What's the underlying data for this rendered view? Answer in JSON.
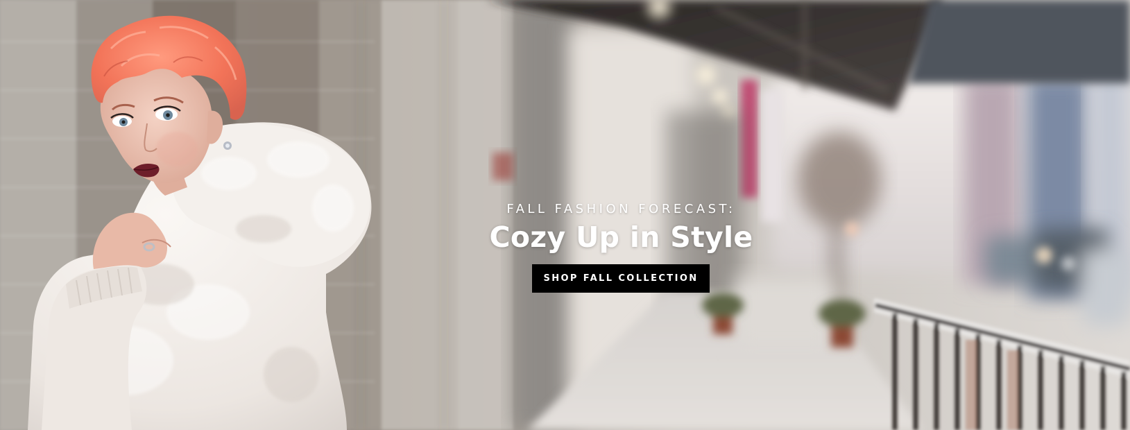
{
  "hero": {
    "eyebrow": "FALL FASHION FORECAST:",
    "headline": "Cozy Up in Style",
    "cta_label": "SHOP FALL COLLECTION"
  },
  "colors": {
    "cta_background": "#000000",
    "text": "#ffffff",
    "hair": "#f07a60",
    "coat": "#f1ece8"
  }
}
